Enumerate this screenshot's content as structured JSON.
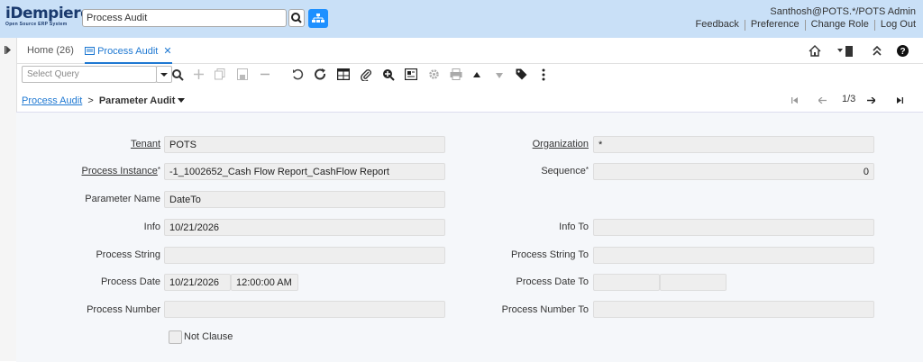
{
  "header": {
    "logo_main": "iDempiere",
    "logo_sub": "Open Source ERP System",
    "search_value": "Process Audit",
    "user": "Santhosh@POTS.*/POTS Admin",
    "links": [
      "Feedback",
      "Preference",
      "Change Role",
      "Log Out"
    ]
  },
  "tabs": [
    {
      "label": "Home (26)"
    },
    {
      "label": "Process Audit"
    }
  ],
  "toolbar": {
    "query_placeholder": "Select Query"
  },
  "breadcrumb": {
    "parent": "Process Audit",
    "separator": ">",
    "current": "Parameter Audit"
  },
  "record_nav": {
    "position": "1/3"
  },
  "form": {
    "tenant": {
      "label": "Tenant",
      "value": "POTS"
    },
    "organization": {
      "label": "Organization",
      "value": "*"
    },
    "process_instance": {
      "label": "Process Instance",
      "value": "-1_1002652_Cash Flow Report_CashFlow Report"
    },
    "sequence": {
      "label": "Sequence",
      "value": "0"
    },
    "parameter_name": {
      "label": "Parameter Name",
      "value": "DateTo"
    },
    "info": {
      "label": "Info",
      "value": "10/21/2026"
    },
    "info_to": {
      "label": "Info To",
      "value": ""
    },
    "process_string": {
      "label": "Process String",
      "value": ""
    },
    "process_string_to": {
      "label": "Process String To",
      "value": ""
    },
    "process_date": {
      "label": "Process Date",
      "date": "10/21/2026",
      "time": "12:00:00 AM"
    },
    "process_date_to": {
      "label": "Process Date To",
      "date": "",
      "time": ""
    },
    "process_number": {
      "label": "Process Number",
      "value": ""
    },
    "process_number_to": {
      "label": "Process Number To",
      "value": ""
    },
    "not_clause": {
      "label": "Not Clause",
      "checked": false
    }
  },
  "colors": {
    "header_bg": "#c9e0f7",
    "accent": "#1e78d2",
    "tree_button": "#1e90ff",
    "field_bg": "#eeeeee"
  }
}
